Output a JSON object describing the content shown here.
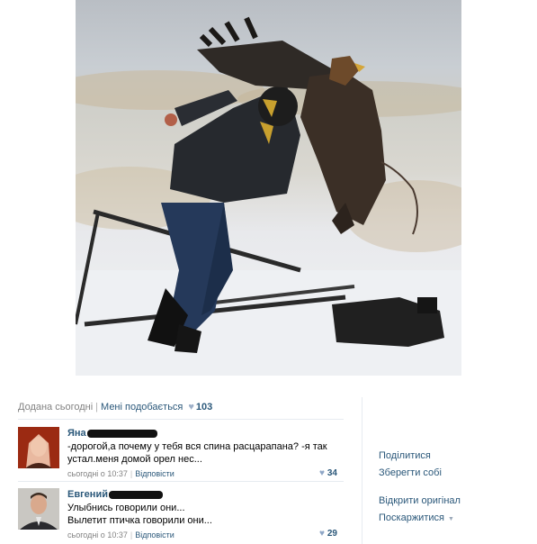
{
  "post": {
    "added": "Додана сьогодні",
    "sep": "|",
    "like_label": "Мені подобається",
    "heart_icon": "heart-icon",
    "likes": "103"
  },
  "comments": [
    {
      "name": "Яна",
      "text_lines": [
        "-дорогой,а почему у тебя вся спина расцарапана? -я так",
        "устал.меня домой орел нес..."
      ],
      "time": "сьогодні о 10:37",
      "sep": "|",
      "reply": "Відповісти",
      "likes": "34"
    },
    {
      "name": "Евгений",
      "text_lines": [
        "Улыбнись говорили они...",
        "Вылетит птичка говорили они..."
      ],
      "time": "сьогодні о 10:37",
      "sep": "|",
      "reply": "Відповісти",
      "likes": "29"
    }
  ],
  "actions": {
    "share": "Поділитися",
    "save": "Зберегти собі",
    "open_original": "Відкрити оригінал",
    "report": "Поскаржитися",
    "report_arrow": "▼"
  },
  "colors": {
    "link": "#2b587a",
    "muted": "#828282",
    "divider": "#e7ebf0"
  }
}
